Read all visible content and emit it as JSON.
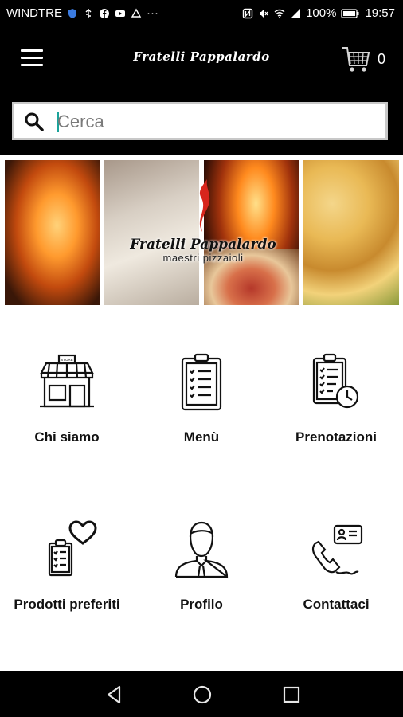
{
  "status_bar": {
    "carrier": "WINDTRE",
    "battery": "100%",
    "time": "19:57"
  },
  "header": {
    "menu_icon": "hamburger-menu-icon",
    "brand": "Fratelli Pappalardo",
    "cart_icon": "shopping-cart-icon",
    "cart_count": "0"
  },
  "search": {
    "placeholder": "Cerca",
    "value": "",
    "icon": "search-icon"
  },
  "banner": {
    "logo_main": "Fratelli Pappalardo",
    "logo_sub": "maestri pizzaioli"
  },
  "menu_tiles": [
    {
      "label": "Chi siamo",
      "icon": "store-icon"
    },
    {
      "label": "Menù",
      "icon": "clipboard-checklist-icon"
    },
    {
      "label": "Prenotazioni",
      "icon": "clipboard-clock-icon"
    },
    {
      "label": "Prodotti preferiti",
      "icon": "clipboard-heart-icon"
    },
    {
      "label": "Profilo",
      "icon": "user-profile-icon"
    },
    {
      "label": "Contattaci",
      "icon": "phone-contact-icon"
    }
  ],
  "nav_bar": {
    "back": "back-triangle-icon",
    "home": "home-circle-icon",
    "recents": "recents-square-icon"
  },
  "colors": {
    "bar_background": "#000000",
    "search_border": "#c8c8c8",
    "caret": "#1aa39a"
  }
}
